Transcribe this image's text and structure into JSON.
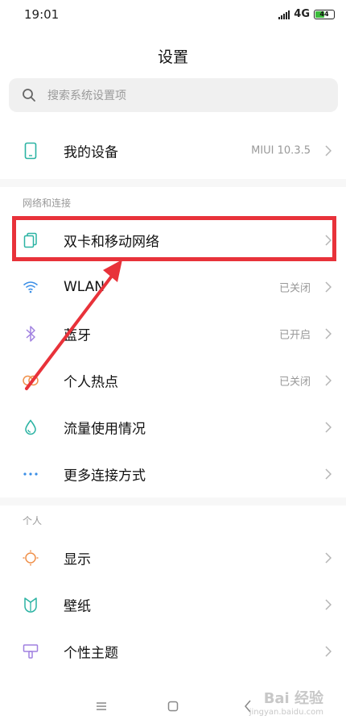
{
  "status_bar": {
    "time": "19:01",
    "network": "4G",
    "battery": "44"
  },
  "header": {
    "title": "设置"
  },
  "search": {
    "placeholder": "搜索系统设置项"
  },
  "device": {
    "label": "我的设备",
    "value": "MIUI 10.3.5",
    "icon": "phone-icon"
  },
  "sections": {
    "network_title": "网络和连接",
    "personal_title": "个人"
  },
  "network_items": [
    {
      "label": "双卡和移动网络",
      "value": "",
      "icon": "sim-card-icon"
    },
    {
      "label": "WLAN",
      "value": "已关闭",
      "icon": "wifi-icon"
    },
    {
      "label": "蓝牙",
      "value": "已开启",
      "icon": "bluetooth-icon"
    },
    {
      "label": "个人热点",
      "value": "已关闭",
      "icon": "hotspot-icon"
    },
    {
      "label": "流量使用情况",
      "value": "",
      "icon": "data-usage-icon"
    },
    {
      "label": "更多连接方式",
      "value": "",
      "icon": "more-icon"
    }
  ],
  "personal_items": [
    {
      "label": "显示",
      "icon": "display-icon"
    },
    {
      "label": "壁纸",
      "icon": "wallpaper-icon"
    },
    {
      "label": "个性主题",
      "icon": "theme-icon"
    }
  ],
  "watermark": {
    "text": "Bai 经验",
    "url": "jingyan.baidu.com"
  },
  "colors": {
    "highlight": "#e8323a",
    "arrow": "#e8323a",
    "icon_teal": "#2bb3a3",
    "icon_blue": "#3a8ee6",
    "icon_purple": "#a080e0",
    "icon_orange": "#f0904a"
  }
}
